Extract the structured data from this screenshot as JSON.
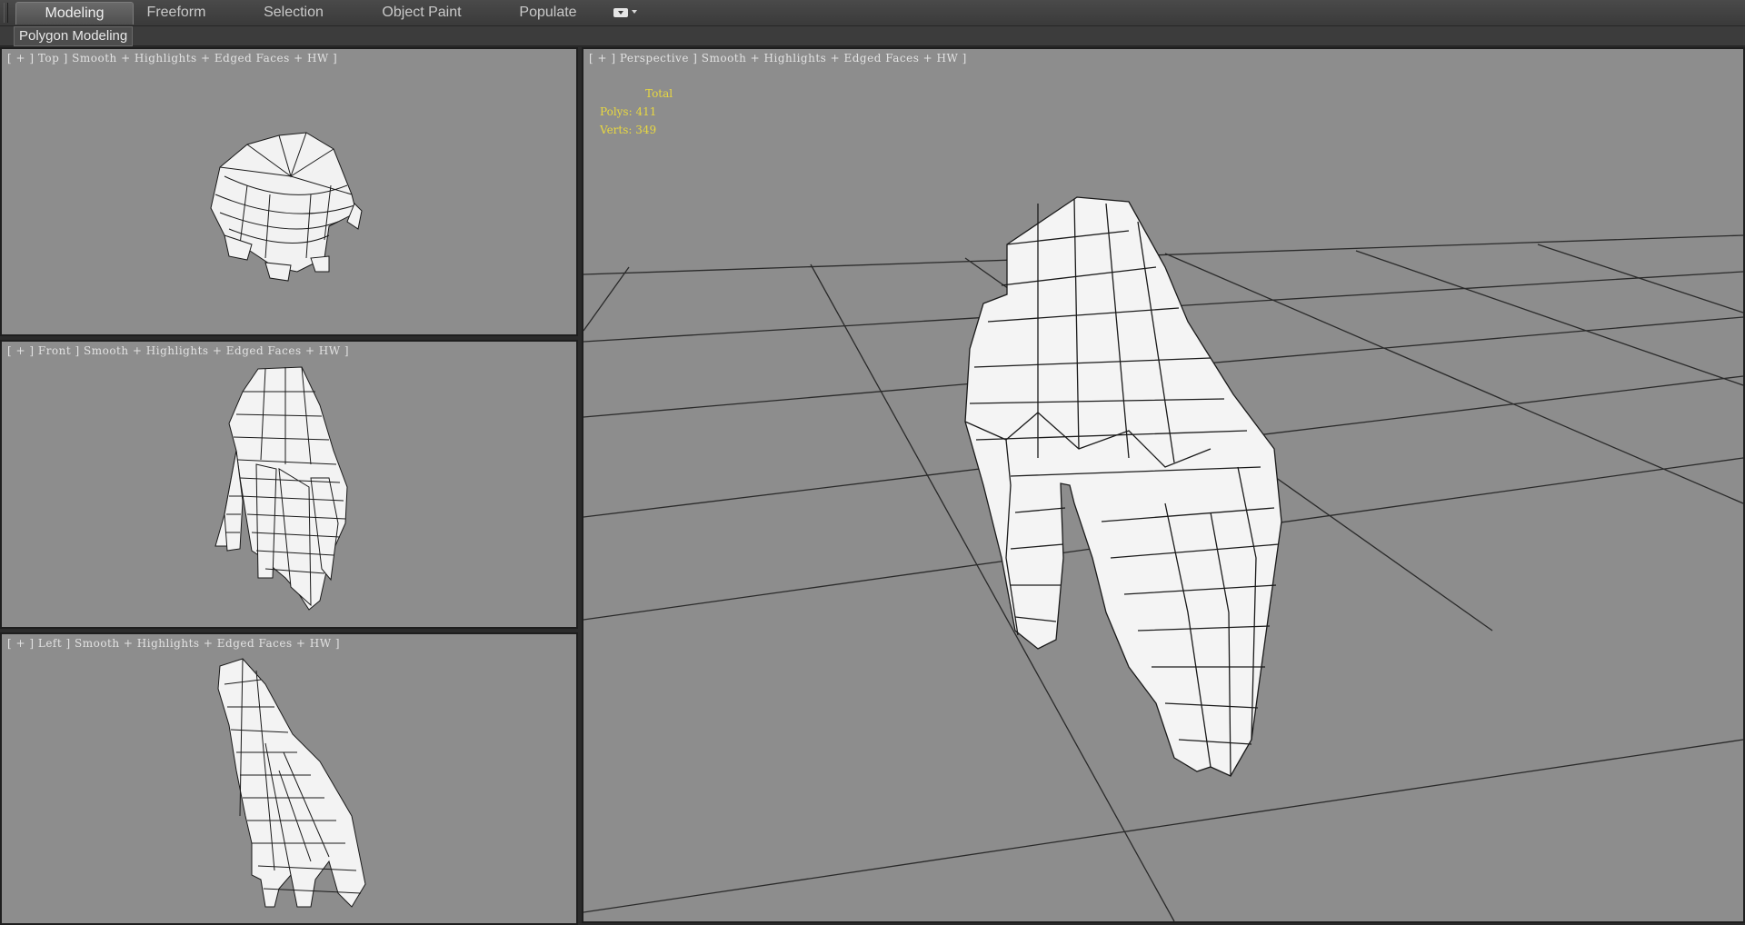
{
  "ribbon": {
    "tabs": [
      {
        "label": "Modeling",
        "active": true
      },
      {
        "label": "Freeform",
        "active": false
      },
      {
        "label": "Selection",
        "active": false
      },
      {
        "label": "Object Paint",
        "active": false
      },
      {
        "label": "Populate",
        "active": false
      }
    ],
    "menu_icon": "ribbon-options-icon"
  },
  "subribbon": {
    "panel_label": "Polygon Modeling"
  },
  "viewports": {
    "top": {
      "label": "[ + ] Top ] Smooth + Highlights + Edged Faces + HW ]"
    },
    "front": {
      "label": "[ + ] Front ] Smooth + Highlights + Edged Faces + HW ]"
    },
    "left": {
      "label": "[ + ] Left ] Smooth + Highlights + Edged Faces + HW ]"
    },
    "perspective": {
      "label": "[ + ] Perspective ] Smooth + Highlights + Edged Faces + HW ]",
      "stats": {
        "header": "Total",
        "polys": "Polys: 411",
        "verts": "Verts: 349"
      }
    }
  },
  "colors": {
    "viewport_bg": "#8d8d8d",
    "stats_text": "#e8d840",
    "grid_lines": "#2a2a2a",
    "mesh_fill": "#f4f4f4",
    "mesh_edges": "#1a1a1a"
  }
}
